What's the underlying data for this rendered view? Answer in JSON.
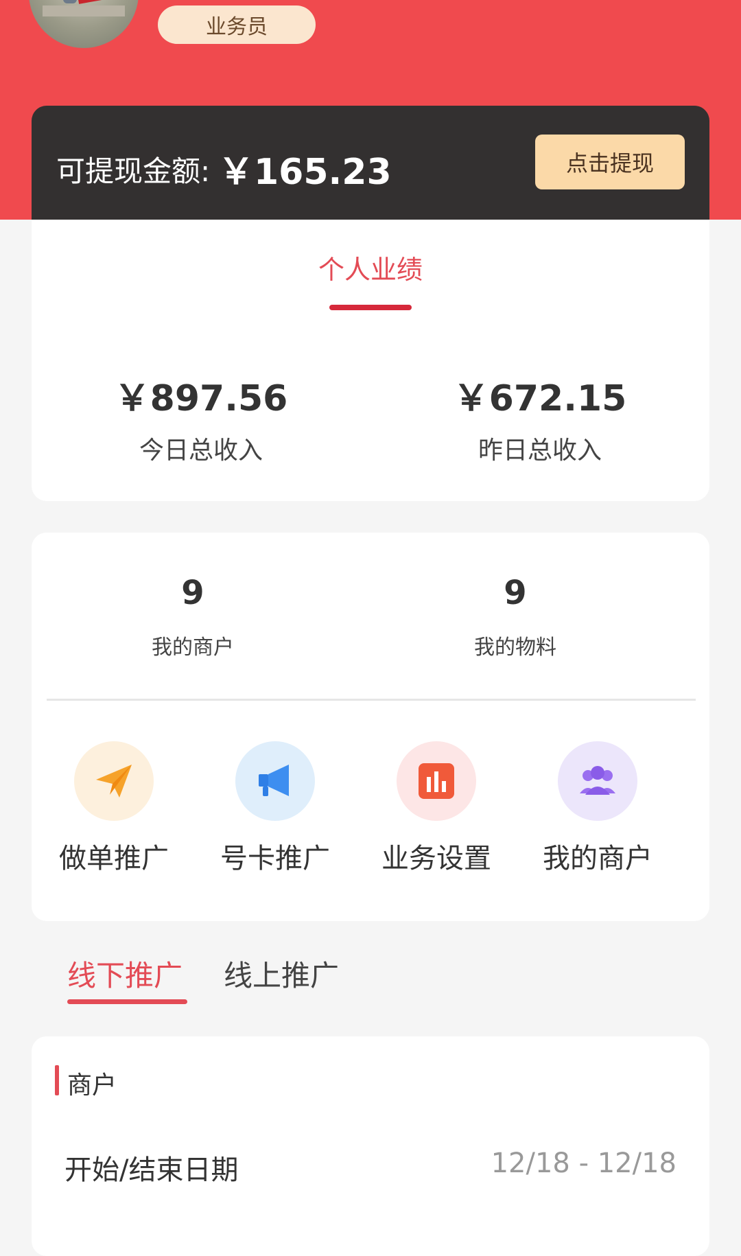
{
  "profile": {
    "role": "业务员"
  },
  "balance": {
    "label": "可提现金额:",
    "amount": "￥165.23",
    "withdraw_label": "点击提现"
  },
  "performance": {
    "title": "个人业绩",
    "today": {
      "amount": "￥897.56",
      "label": "今日总收入"
    },
    "yesterday": {
      "amount": "￥672.15",
      "label": "昨日总收入"
    }
  },
  "counts": {
    "merchants": {
      "value": "9",
      "label": "我的商户"
    },
    "materials": {
      "value": "9",
      "label": "我的物料"
    }
  },
  "actions": [
    {
      "label": "做单推广",
      "icon": "paper-plane-icon"
    },
    {
      "label": "号卡推广",
      "icon": "megaphone-icon"
    },
    {
      "label": "业务设置",
      "icon": "bar-chart-icon"
    },
    {
      "label": "我的商户",
      "icon": "users-icon"
    }
  ],
  "tabs": {
    "offline": "线下推广",
    "online": "线上推广"
  },
  "filter": {
    "section_title": "商户",
    "date_label": "开始/结束日期",
    "date_value": "12/18 - 12/18"
  },
  "colors": {
    "header": "#f04a4e",
    "accent": "#e34b55",
    "card_dark": "#333030",
    "button_gold": "#fbd9a8"
  }
}
